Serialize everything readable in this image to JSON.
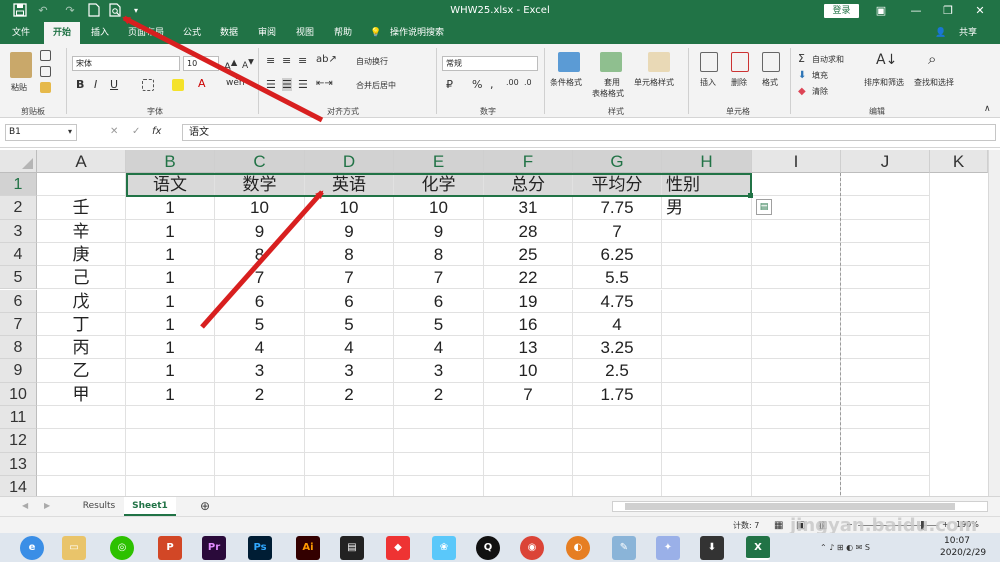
{
  "window": {
    "title": "WHW25.xlsx  -  Excel",
    "login_label": "登录"
  },
  "ribbon_tabs": [
    {
      "label": "文件"
    },
    {
      "label": "开始"
    },
    {
      "label": "插入"
    },
    {
      "label": "页面布局"
    },
    {
      "label": "公式"
    },
    {
      "label": "数据"
    },
    {
      "label": "审阅"
    },
    {
      "label": "视图"
    },
    {
      "label": "帮助"
    },
    {
      "label": "操作说明搜索"
    },
    {
      "label": "共享"
    }
  ],
  "ribbon": {
    "paste": "粘贴",
    "font_name": "宋体",
    "font_size": "10",
    "wrap_text": "自动换行",
    "merge_center": "合并后居中",
    "number_format": "常规",
    "percent": "%",
    "comma": ",",
    "cond_format": "条件格式",
    "table_format_1": "套用",
    "table_format_2": "表格格式",
    "cell_style": "单元格样式",
    "insert": "插入",
    "delete": "删除",
    "format": "格式",
    "autosum": "自动求和",
    "fill": "填充",
    "clear": "清除",
    "sort_filter": "排序和筛选",
    "find_select": "查找和选择",
    "groups": [
      "剪贴板",
      "字体",
      "对齐方式",
      "数字",
      "样式",
      "单元格",
      "编辑"
    ]
  },
  "formula_bar": {
    "name_box": "B1",
    "fx": "fx",
    "content": "语文"
  },
  "sheet": {
    "columns": [
      "A",
      "B",
      "C",
      "D",
      "E",
      "F",
      "G",
      "H",
      "I",
      "J",
      "K"
    ],
    "rows": [
      "1",
      "2",
      "3",
      "4",
      "5",
      "6",
      "7",
      "8",
      "9",
      "10",
      "11",
      "12",
      "13",
      "14"
    ],
    "cells": [
      [
        "",
        "语文",
        "数学",
        "英语",
        "化学",
        "总分",
        "平均分",
        "性别"
      ],
      [
        "壬",
        "1",
        "10",
        "10",
        "10",
        "31",
        "7.75",
        "男"
      ],
      [
        "辛",
        "1",
        "9",
        "9",
        "9",
        "28",
        "7",
        ""
      ],
      [
        "庚",
        "1",
        "8",
        "8",
        "8",
        "25",
        "6.25",
        ""
      ],
      [
        "己",
        "1",
        "7",
        "7",
        "7",
        "22",
        "5.5",
        ""
      ],
      [
        "戊",
        "1",
        "6",
        "6",
        "6",
        "19",
        "4.75",
        ""
      ],
      [
        "丁",
        "1",
        "5",
        "5",
        "5",
        "16",
        "4",
        ""
      ],
      [
        "丙",
        "1",
        "4",
        "4",
        "4",
        "13",
        "3.25",
        ""
      ],
      [
        "乙",
        "1",
        "3",
        "3",
        "3",
        "10",
        "2.5",
        ""
      ],
      [
        "甲",
        "1",
        "2",
        "2",
        "2",
        "7",
        "1.75",
        ""
      ]
    ]
  },
  "sheet_tabs": [
    {
      "label": "Results"
    },
    {
      "label": "Sheet1"
    }
  ],
  "status": {
    "count": "计数: 7",
    "zoom": "190%",
    "watermark": "jingyan.baidu.com"
  },
  "taskbar": {
    "time": "10:07",
    "date": "2020/2/29"
  },
  "colors": {
    "excel_green": "#217346",
    "arrow_red": "#d81f1f"
  }
}
